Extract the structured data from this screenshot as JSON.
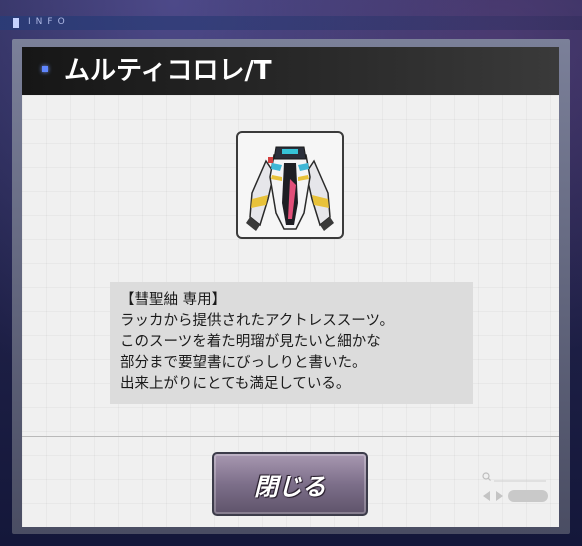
{
  "header": {
    "tag_label": "INFO"
  },
  "item": {
    "name": "ムルティコロレ/T",
    "icon": "costume-suit-icon",
    "description": [
      "【彗聖紬 専用】",
      "ラッカから提供されたアクトレススーツ。",
      "このスーツを着た明瑠が見たいと細かな",
      "部分まで要望書にびっしりと書いた。",
      "出来上がりにとても満足している。"
    ]
  },
  "buttons": {
    "close_label": "閉じる"
  },
  "colors": {
    "accent": "#5f86ff",
    "button": "#7d6f8a",
    "panel": "#f0f0f0",
    "title_bar": "#1f1f1f"
  }
}
